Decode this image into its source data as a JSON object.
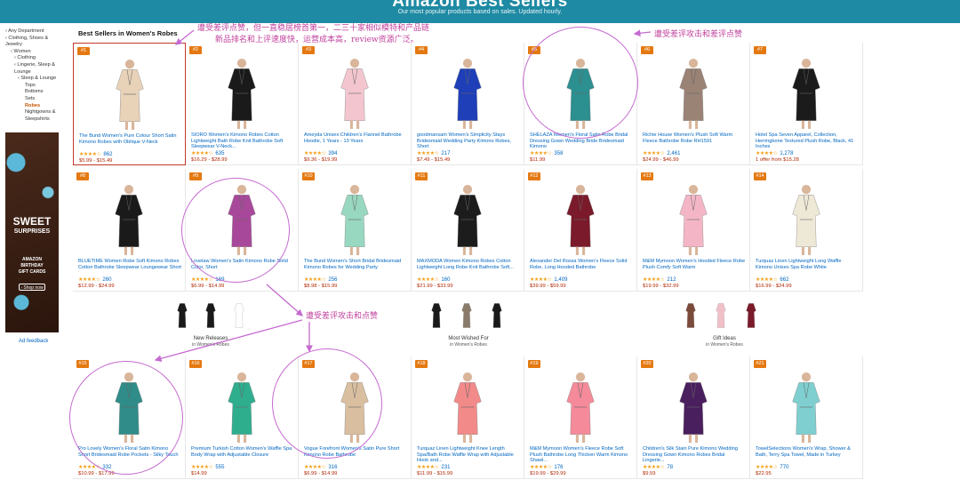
{
  "header": {
    "title": "Amazon Best Sellers",
    "subtitle": "Our most popular products based on sales. Updated hourly."
  },
  "sidebar": {
    "items": [
      {
        "label": "‹ Any Department",
        "level": 0
      },
      {
        "label": "‹ Clothing, Shoes & Jewelry",
        "level": 0
      },
      {
        "label": "‹ Women",
        "level": 1
      },
      {
        "label": "‹ Clothing",
        "level": 2
      },
      {
        "label": "‹ Lingerie, Sleep & Lounge",
        "level": 2
      },
      {
        "label": "‹ Sleep & Lounge",
        "level": 3
      },
      {
        "label": "Tops",
        "level": 4
      },
      {
        "label": "Bottoms",
        "level": 4
      },
      {
        "label": "Sets",
        "level": 4
      },
      {
        "label": "Robes",
        "level": 4,
        "active": true
      },
      {
        "label": "Nightgowns & Sleepshirts",
        "level": 4
      }
    ]
  },
  "ad": {
    "headline": "SWEET",
    "subheadline": "SURPRISES",
    "brand": "AMAZON",
    "line1": "BIRTHDAY",
    "line2": "GIFT CARDS",
    "cta": "› Shop now",
    "feedback": "Ad feedback"
  },
  "section_title": "Best Sellers in Women's Robes",
  "products": [
    {
      "rank": "#1",
      "title": "The Bund Women's Pure Colour Short Satin Kimono Robes with Oblique V-Neck",
      "stars": "★★★★☆",
      "reviews": "862",
      "price": "$5.99 - $15.49",
      "color": "#e8d2b8"
    },
    {
      "rank": "#2",
      "title": "SIORO Women's Kimono Robes Cotton Lightweight Bath Robe Knit Bathrobe Soft Sleepwear V-Neck...",
      "stars": "★★★★☆",
      "reviews": "635",
      "price": "$16.29 - $28.99",
      "color": "#1a1a1a"
    },
    {
      "rank": "#3",
      "title": "Ameyda Unisex Children's Flannel Bathrobe Hoodie, 1 Years - 13 Years",
      "stars": "★★★★☆",
      "reviews": "394",
      "price": "$9.36 - $19.99",
      "color": "#f3c6cf"
    },
    {
      "rank": "#4",
      "title": "goodmansam Women's Simplicity Stays Bridesmaid Wedding Party Kimono Robes, Short",
      "stars": "★★★★☆",
      "reviews": "217",
      "price": "$7.49 - $15.49",
      "color": "#1f3fb8"
    },
    {
      "rank": "#5",
      "title": "SHELAZA Women's Floral Satin Robe Bridal Dressing Gown Wedding Bride Bridesmaid Kimono",
      "stars": "★★★★☆",
      "reviews": "358",
      "price": "$11.99",
      "color": "#2c8f90"
    },
    {
      "rank": "#6",
      "title": "Richie House Women's Plush Soft Warm Fleece Bathrobe Robe RH1591",
      "stars": "★★★★☆",
      "reviews": "2,461",
      "price": "$24.99 - $46.99",
      "color": "#9a8275"
    },
    {
      "rank": "#7",
      "title": "Hotel Spa Seven Apparel, Collection, Herringbone Textured Plush Robe, Black, 41 Inches",
      "stars": "★★★★☆",
      "reviews": "1,278",
      "price": "1 offer from $15.28",
      "color": "#1b1b1b"
    },
    {
      "rank": "#8",
      "title": "BLUETIME Women Robe Soft Kimono Robes Cotton Bathrobe Sleepwear Loungewear Short",
      "stars": "★★★★☆",
      "reviews": "260",
      "price": "$12.99 - $24.99",
      "color": "#1a1a1a"
    },
    {
      "rank": "#9",
      "title": "Lnvelaw Women's Satin Kimono Robe Solid Color, Short",
      "stars": "★★★★☆",
      "reviews": "169",
      "price": "$6.99 - $14.99",
      "color": "#a8489a"
    },
    {
      "rank": "#10",
      "title": "The Bund Women's Short Bridal Bridesmaid Kimono Robes for Wedding Party",
      "stars": "★★★★☆",
      "reviews": "256",
      "price": "$8.98 - $15.99",
      "color": "#98d7c0"
    },
    {
      "rank": "#11",
      "title": "MAXMODA Women Kimono Robes Cotton Lightweight Long Robe Knit Bathrobe Soft...",
      "stars": "★★★★☆",
      "reviews": "160",
      "price": "$21.99 - $33.99",
      "color": "#1c1c1c"
    },
    {
      "rank": "#12",
      "title": "Alexander Del Rossa Women's Fleece Solid Robe, Long Hooded Bathrobe",
      "stars": "★★★★☆",
      "reviews": "1,409",
      "price": "$39.99 - $59.99",
      "color": "#7a1a2a"
    },
    {
      "rank": "#13",
      "title": "M&M Mymoon Women's Hooded Fleece Robe Plush Comfy Soft Warm",
      "stars": "★★★★☆",
      "reviews": "212",
      "price": "$19.99 - $32.99",
      "color": "#f4b6c7"
    },
    {
      "rank": "#14",
      "title": "Turquaz Linen Lightweight Long Waffle Kimono Unisex Spa Robe White",
      "stars": "★★★★☆",
      "reviews": "662",
      "price": "$16.99 - $24.99",
      "color": "#eee8d6"
    },
    {
      "rank": "#15",
      "title": "Pro Lovely Women's Floral Satin Kimono Short Bridesmaid Robe Pockets - Silky Touch",
      "stars": "★★★★☆",
      "reviews": "332",
      "price": "$10.99 - $17.99",
      "color": "#2f8c88"
    },
    {
      "rank": "#16",
      "title": "Premium Turkish Cotton Women's Waffle Spa Body Wrap with Adjustable Closure",
      "stars": "★★★★☆",
      "reviews": "555",
      "price": "$14.99",
      "color": "#2fae8e"
    },
    {
      "rank": "#17",
      "title": "Vogue Forefront Women's Satin Pure Short Kimono Robe Bathrobe",
      "stars": "★★★★☆",
      "reviews": "316",
      "price": "$6.99 - $14.99",
      "color": "#d9bfa0"
    },
    {
      "rank": "#18",
      "title": "Turquaz Linen Lightweight Knee Length Spa/Bath Robe Waffle Wrap with Adjustable Hook and...",
      "stars": "★★★★☆",
      "reviews": "231",
      "price": "$11.99 - $15.99",
      "color": "#f28a8a"
    },
    {
      "rank": "#19",
      "title": "M&M Mymoon Women's Fleece Robe Soft Plush Bathrobe Long Thicken Warm Kimono Shawl...",
      "stars": "★★★★☆",
      "reviews": "176",
      "price": "$19.99 - $29.99",
      "color": "#f58a9a"
    },
    {
      "rank": "#20",
      "title": "Children's Silk Stain Pure Kimono Wedding Dressing Gown Kimono Robes Bridal Lingerie...",
      "stars": "★★★★☆",
      "reviews": "78",
      "price": "$9.59",
      "color": "#4a1f5e"
    },
    {
      "rank": "#21",
      "title": "TowelSelections Women's Wrap, Shower & Bath, Terry Spa Towel, Made in Turkey",
      "stars": "★★★★☆",
      "reviews": "770",
      "price": "$22.95",
      "color": "#7fcfd0"
    }
  ],
  "mid_row": [
    {
      "label": "New Releases",
      "sublabel": "in Women's Robes",
      "colors": [
        "#1a1a1a",
        "#1a1a1a",
        "#ffffff"
      ]
    },
    {
      "label": "Most Wished For",
      "sublabel": "in Women's Robes",
      "colors": [
        "#1a1a1a",
        "#8a7a6a",
        "#1a1a1a"
      ]
    },
    {
      "label": "Gift Ideas",
      "sublabel": "in Women's Robes",
      "colors": [
        "#7a4a3a",
        "#f0c0c8",
        "#7a1a2a"
      ]
    }
  ],
  "annotations": {
    "note1_line1": "遭受差评点赞，但一直稳居榜首第一，二三十家相似模特和产品链",
    "note1_line2": "新品排名和上评速度快，运营成本高，review资源广泛。",
    "note2": "遭受差评攻击和差评点赞",
    "note3": "遭受差评攻击和点赞"
  }
}
